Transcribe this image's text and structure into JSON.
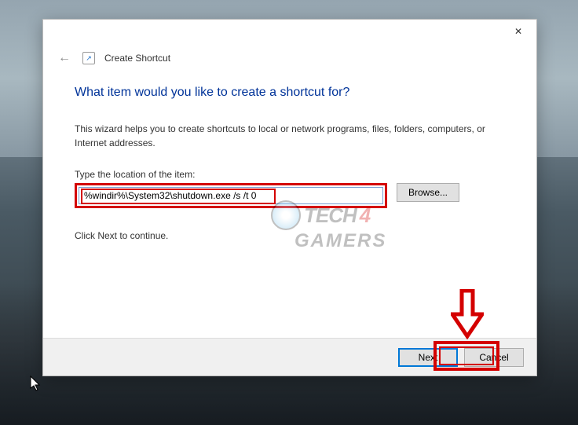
{
  "dialog": {
    "title": "Create Shortcut",
    "close_label": "✕",
    "heading": "What item would you like to create a shortcut for?",
    "description": "This wizard helps you to create shortcuts to local or network programs, files, folders, computers, or Internet addresses.",
    "location_label": "Type the location of the item:",
    "location_value": "%windir%\\System32\\shutdown.exe /s /t 0",
    "browse_label": "Browse...",
    "continue_text": "Click Next to continue.",
    "next_label": "Next",
    "cancel_label": "Cancel"
  },
  "watermark": {
    "text1": "TECH",
    "mid": "4",
    "text2": "GAMERS"
  },
  "annotations": {
    "highlight_color": "#d40000",
    "input_highlighted": true,
    "next_highlighted": true
  }
}
